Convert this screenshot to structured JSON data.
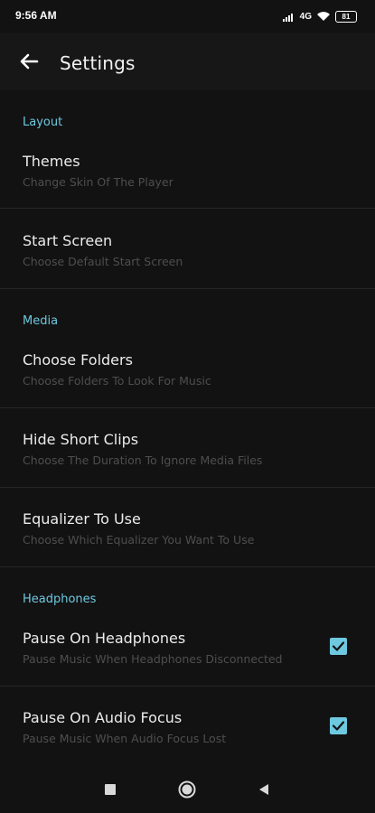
{
  "status_bar": {
    "time": "9:56 AM",
    "network": "4G",
    "battery": "81"
  },
  "app_bar": {
    "title": "Settings"
  },
  "sections": [
    {
      "header": "Layout"
    },
    {
      "header": "Media"
    },
    {
      "header": "Headphones"
    }
  ],
  "prefs": {
    "themes": {
      "title": "Themes",
      "summary": "Change Skin Of The Player"
    },
    "start_screen": {
      "title": "Start Screen",
      "summary": "Choose Default Start Screen"
    },
    "choose_folders": {
      "title": "Choose Folders",
      "summary": "Choose Folders To Look For Music"
    },
    "hide_short_clips": {
      "title": "Hide Short Clips",
      "summary": "Choose The Duration To Ignore Media Files"
    },
    "equalizer": {
      "title": "Equalizer To Use",
      "summary": "Choose Which Equalizer You Want To Use"
    },
    "pause_headphones": {
      "title": "Pause On Headphones",
      "summary": "Pause Music When Headphones Disconnected",
      "checked": true
    },
    "pause_audio_focus": {
      "title": "Pause On Audio Focus",
      "summary": "Pause Music When Audio Focus Lost",
      "checked": true
    }
  },
  "colors": {
    "accent": "#6ec8e0",
    "background": "#121212",
    "app_bar": "#171717"
  },
  "icons": {
    "back": "arrow-left-icon",
    "signal": "signal-icon",
    "wifi": "wifi-icon",
    "battery": "battery-icon",
    "check": "check-icon",
    "nav_recents": "square-icon",
    "nav_home": "circle-icon",
    "nav_back": "triangle-left-icon"
  }
}
